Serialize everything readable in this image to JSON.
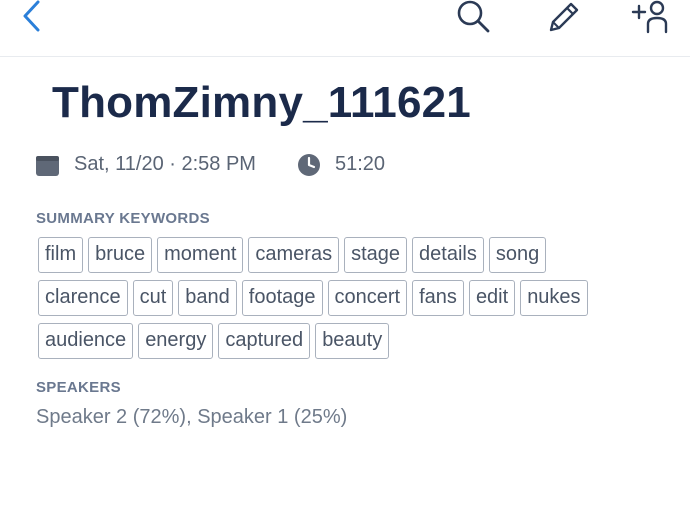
{
  "header": {
    "back_icon": "chevron-left-icon",
    "search_icon": "search-icon",
    "edit_icon": "pencil-icon",
    "add_user_icon": "add-user-icon",
    "accent_color": "#2b7fd9"
  },
  "title": "ThomZimny_111621",
  "meta": {
    "calendar_icon": "calendar-icon",
    "date_text": "Sat, 11/20 · 2:58 PM",
    "clock_icon": "clock-icon",
    "duration_text": "51:20"
  },
  "keywords": {
    "label": "SUMMARY KEYWORDS",
    "rows": [
      [
        "film",
        "bruce",
        "moment",
        "cameras",
        "stage",
        "details",
        "song"
      ],
      [
        "clarence",
        "cut",
        "band",
        "footage",
        "concert",
        "fans",
        "edit",
        "nukes"
      ],
      [
        "audience",
        "energy",
        "captured",
        "beauty"
      ]
    ]
  },
  "speakers": {
    "label": "SPEAKERS",
    "text": "Speaker 2 (72%), Speaker 1 (25%)"
  }
}
